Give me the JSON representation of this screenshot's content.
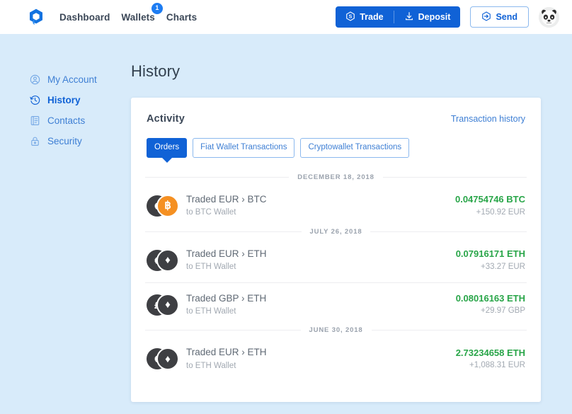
{
  "header": {
    "logo_icon": "hexagon-logo-icon",
    "nav": [
      {
        "label": "Dashboard",
        "badge": null
      },
      {
        "label": "Wallets",
        "badge": "1"
      },
      {
        "label": "Charts",
        "badge": null
      }
    ],
    "actions": {
      "trade_label": "Trade",
      "trade_icon": "dollar-hexagon-icon",
      "deposit_label": "Deposit",
      "deposit_icon": "download-arrow-icon",
      "send_label": "Send",
      "send_icon": "arrow-right-hexagon-icon"
    },
    "avatar_icon": "panda-avatar-icon"
  },
  "sidebar": {
    "items": [
      {
        "label": "My Account",
        "icon": "user-circle-icon",
        "active": false
      },
      {
        "label": "History",
        "icon": "clock-history-icon",
        "active": true
      },
      {
        "label": "Contacts",
        "icon": "address-book-icon",
        "active": false
      },
      {
        "label": "Security",
        "icon": "lock-icon",
        "active": false
      }
    ]
  },
  "main": {
    "page_title": "History",
    "card": {
      "title": "Activity",
      "link": "Transaction history",
      "tabs": [
        {
          "label": "Orders",
          "active": true
        },
        {
          "label": "Fiat Wallet Transactions",
          "active": false
        },
        {
          "label": "Cryptowallet Transactions",
          "active": false
        }
      ],
      "groups": [
        {
          "date": "DECEMBER 18, 2018",
          "rows": [
            {
              "from_symbol": "€",
              "to_symbol": "฿",
              "to_kind": "btc",
              "title": "Traded EUR › BTC",
              "subtitle": "to BTC Wallet",
              "amount": "0.04754746 BTC",
              "fiat": "+150.92 EUR"
            }
          ]
        },
        {
          "date": "JULY 26, 2018",
          "rows": [
            {
              "from_symbol": "€",
              "to_symbol": "♦",
              "to_kind": "eth",
              "title": "Traded EUR › ETH",
              "subtitle": "to ETH Wallet",
              "amount": "0.07916171 ETH",
              "fiat": "+33.27 EUR"
            },
            {
              "from_symbol": "£",
              "to_symbol": "♦",
              "to_kind": "eth",
              "title": "Traded GBP › ETH",
              "subtitle": "to ETH Wallet",
              "amount": "0.08016163 ETH",
              "fiat": "+29.97 GBP"
            }
          ]
        },
        {
          "date": "JUNE 30, 2018",
          "rows": [
            {
              "from_symbol": "€",
              "to_symbol": "♦",
              "to_kind": "eth",
              "title": "Traded EUR › ETH",
              "subtitle": "to ETH Wallet",
              "amount": "2.73234658 ETH",
              "fiat": "+1,088.31 EUR"
            }
          ]
        }
      ]
    }
  },
  "colors": {
    "brand_blue": "#1062d6",
    "link_blue": "#3e7fd4",
    "page_bg": "#d8ebfa",
    "positive_green": "#28a548",
    "btc_orange": "#f59022",
    "coin_dark": "#3e3f43"
  }
}
